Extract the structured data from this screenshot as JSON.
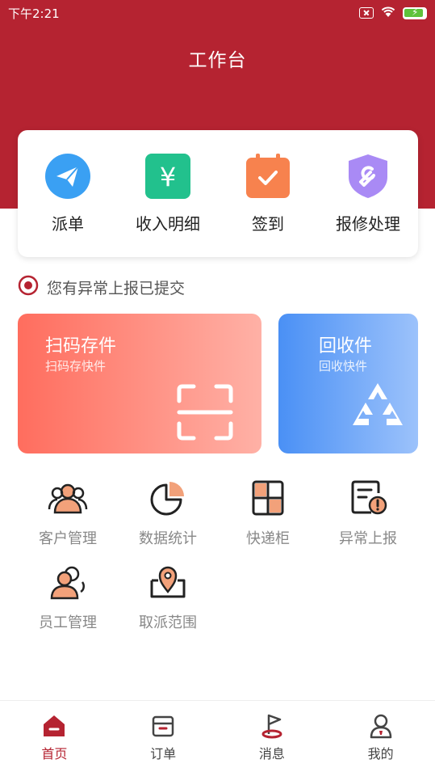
{
  "status_bar": {
    "time": "下午2:21",
    "battery_level": 0.9
  },
  "header": {
    "title": "工作台"
  },
  "quick_actions": [
    {
      "label": "派单",
      "icon": "paper-plane-icon",
      "color": "#3aa0f3"
    },
    {
      "label": "收入明细",
      "icon": "yuan-icon",
      "color": "#22c18d"
    },
    {
      "label": "签到",
      "icon": "calendar-check-icon",
      "color": "#f7824e"
    },
    {
      "label": "报修处理",
      "icon": "wrench-shield-icon",
      "color": "#a98af5"
    }
  ],
  "notice": {
    "text": "您有异常上报已提交",
    "icon": "target-icon"
  },
  "cards": {
    "scan": {
      "title": "扫码存件",
      "subtitle": "扫码存快件",
      "icon": "scan-frame-icon"
    },
    "recycle": {
      "title": "回收件",
      "subtitle": "回收快件",
      "icon": "recycle-icon"
    }
  },
  "grid": [
    {
      "label": "客户管理",
      "icon": "customers-icon"
    },
    {
      "label": "数据统计",
      "icon": "pie-chart-icon"
    },
    {
      "label": "快递柜",
      "icon": "locker-icon"
    },
    {
      "label": "异常上报",
      "icon": "report-alert-icon"
    },
    {
      "label": "员工管理",
      "icon": "staff-icon"
    },
    {
      "label": "取派范围",
      "icon": "map-pin-icon"
    }
  ],
  "tabbar": [
    {
      "label": "首页",
      "icon": "home-icon",
      "active": true
    },
    {
      "label": "订单",
      "icon": "order-box-icon",
      "active": false
    },
    {
      "label": "消息",
      "icon": "flag-message-icon",
      "active": false
    },
    {
      "label": "我的",
      "icon": "user-icon",
      "active": false
    }
  ],
  "colors": {
    "brand": "#b52331",
    "accent_orange": "#f2a17a"
  }
}
